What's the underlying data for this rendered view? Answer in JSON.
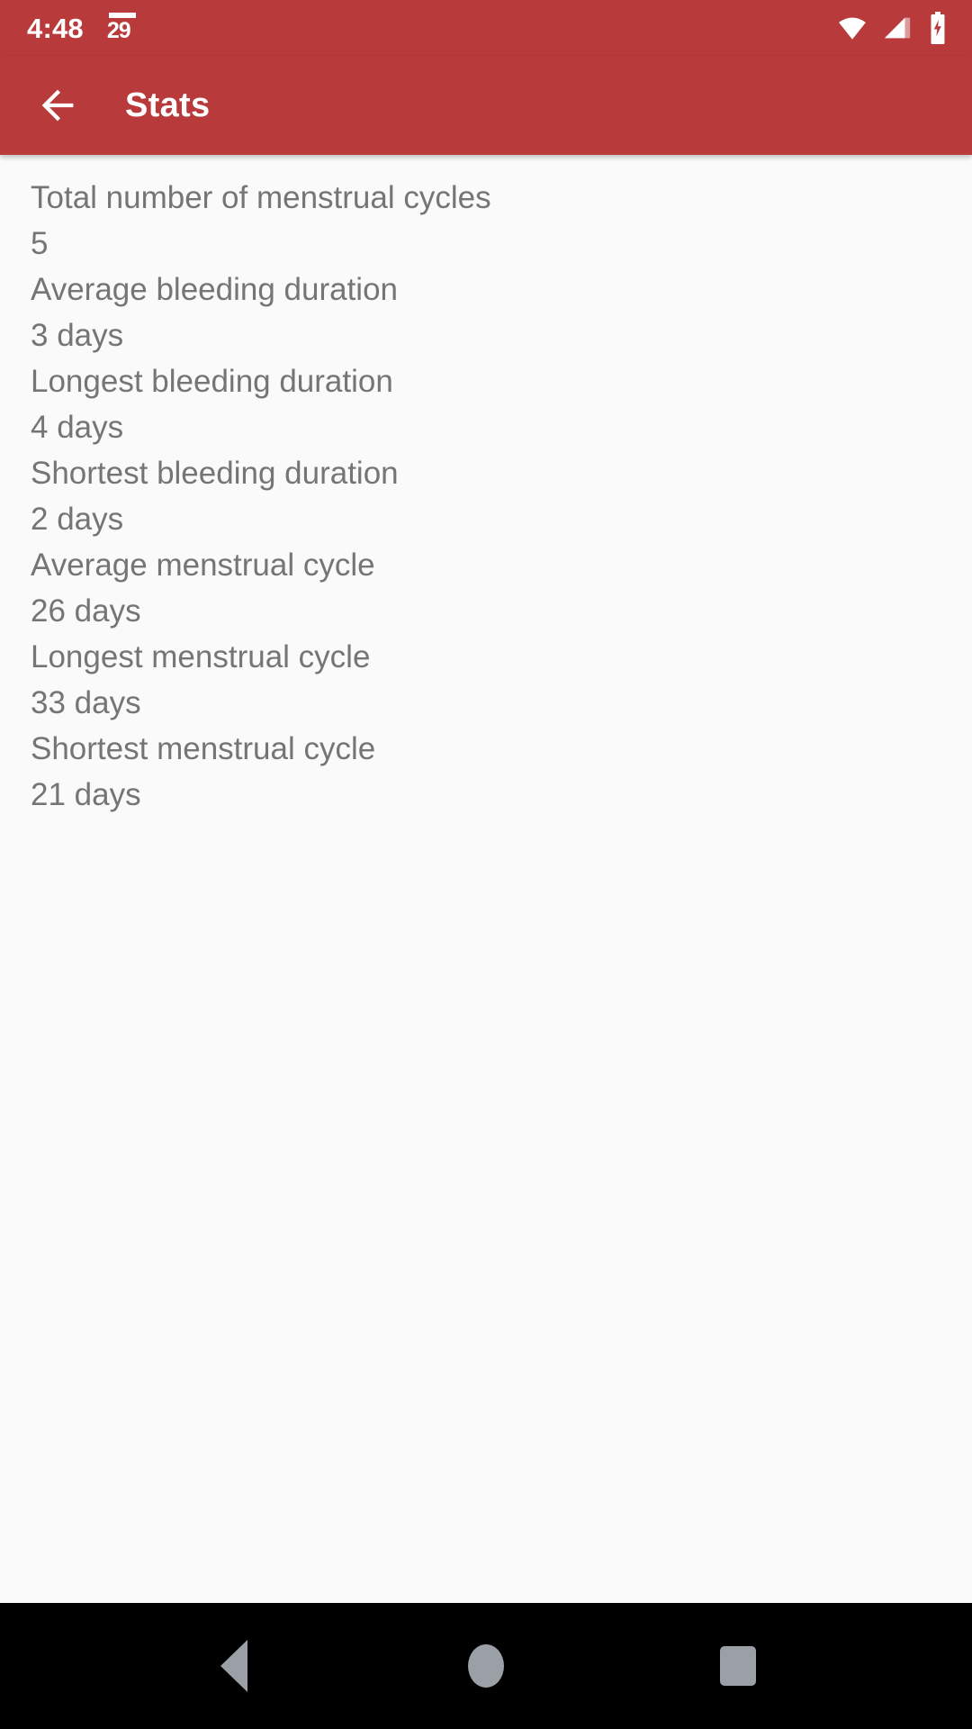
{
  "status_bar": {
    "time": "4:48",
    "notification_icon_label": "29",
    "icons": [
      "cycle-notification-icon",
      "wifi-icon",
      "cellular-signal-icon",
      "battery-charging-icon"
    ],
    "background_color": "#B93A3A"
  },
  "app_bar": {
    "back_label": "back-arrow",
    "title": "Stats",
    "background_color": "#B93A3A",
    "title_color": "#FFFFFF"
  },
  "content": {
    "background_color": "#FAFAFA",
    "text_color": "#757575",
    "stats": [
      {
        "label": "Total number of menstrual cycles",
        "value": "5"
      },
      {
        "label": "Average bleeding duration",
        "value": "3 days"
      },
      {
        "label": "Longest bleeding duration",
        "value": "4 days"
      },
      {
        "label": "Shortest bleeding duration",
        "value": "2 days"
      },
      {
        "label": "Average menstrual cycle",
        "value": "26 days"
      },
      {
        "label": "Longest menstrual cycle",
        "value": "33 days"
      },
      {
        "label": "Shortest menstrual cycle",
        "value": "21 days"
      }
    ]
  },
  "nav_bar": {
    "background_color": "#000000",
    "buttons": [
      "back-triangle",
      "home-circle",
      "recents-square"
    ]
  }
}
